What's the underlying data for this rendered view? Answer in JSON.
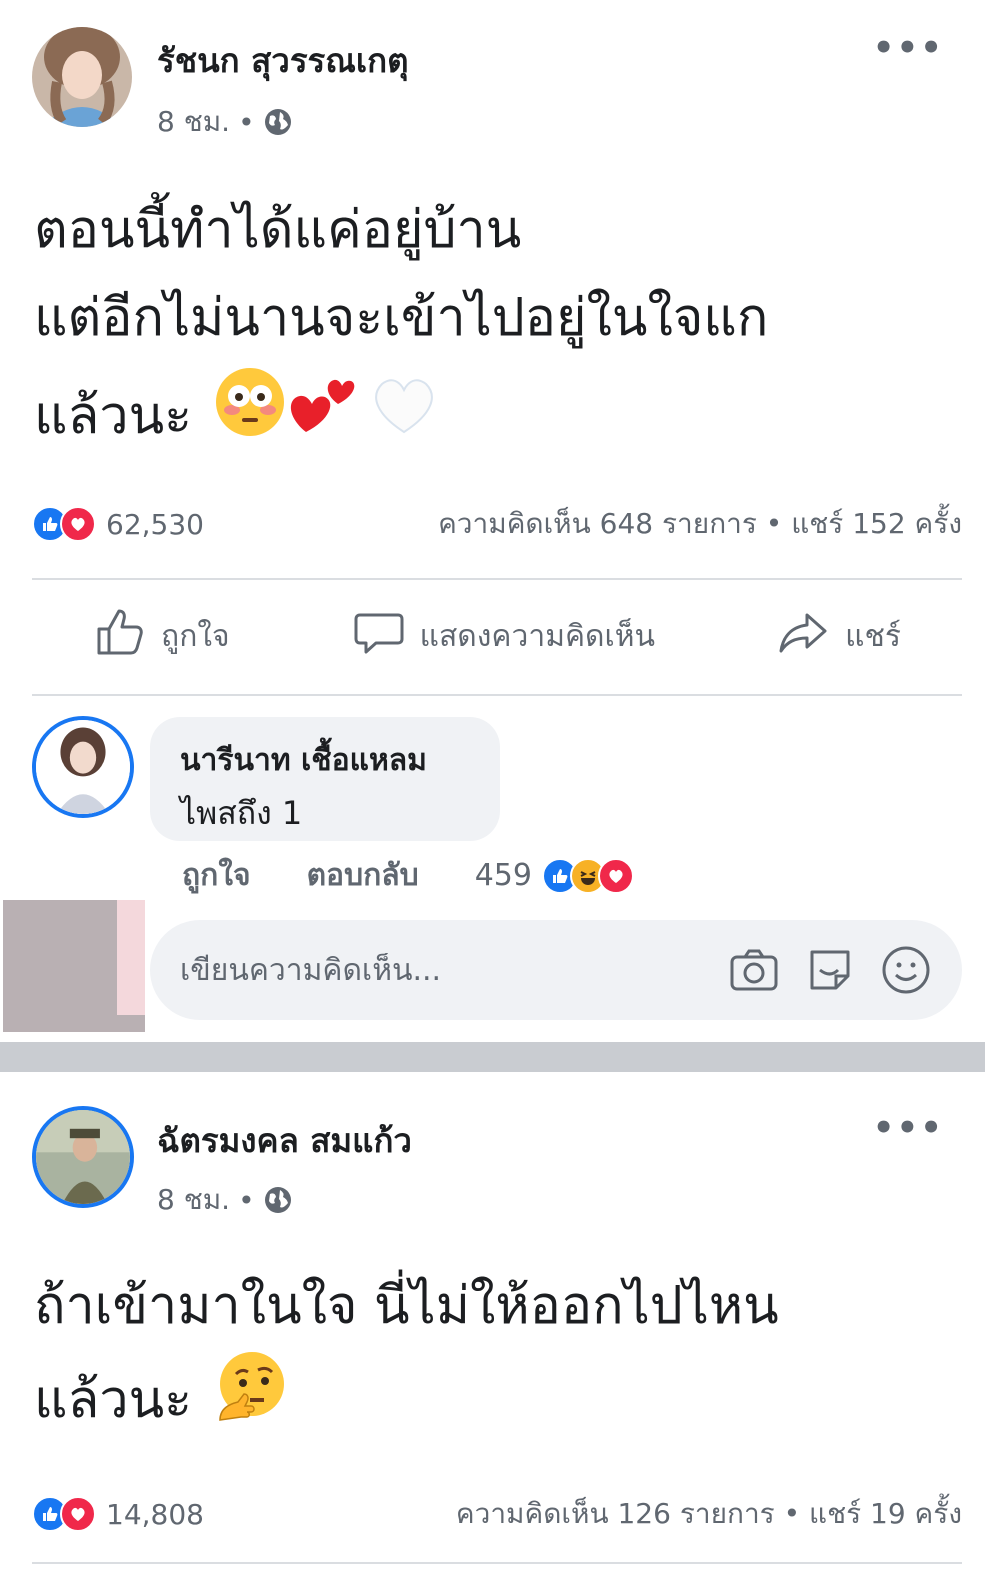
{
  "posts": [
    {
      "author": "รัชนก สุวรรณเกตุ",
      "time": "8 ชม.",
      "dot": "•",
      "more": "•••",
      "lines": [
        "ตอนนี้ทำได้แค่อยู่บ้าน",
        "แต่อีกไม่นานจะเข้าไปอยู่ในใจแก",
        "แล้วนะ"
      ],
      "reactions_count": "62,530",
      "comments_shares": "ความคิดเห็น 648 รายการ • แชร์ 152 ครั้ง",
      "actions": {
        "like": "ถูกใจ",
        "comment": "แสดงความคิดเห็น",
        "share": "แชร์"
      },
      "comment": {
        "author": "นารีนาท เชื้อแหลม",
        "text": "ไพสถึง 1",
        "like": "ถูกใจ",
        "reply": "ตอบกลับ",
        "reaction_count": "459"
      },
      "write_placeholder": "เขียนความคิดเห็น..."
    },
    {
      "author": "ฉัตรมงคล สมแก้ว",
      "time": "8 ชม.",
      "dot": "•",
      "more": "•••",
      "lines": [
        "ถ้าเข้ามาในใจ นี่ไม่ให้ออกไปไหน",
        "แล้วนะ"
      ],
      "reactions_count": "14,808",
      "comments_shares": "ความคิดเห็น 126 รายการ • แชร์ 19 ครั้ง"
    }
  ],
  "icons": {
    "post1_emojis": [
      "flushed-face-emoji",
      "two-hearts-emoji",
      "white-heart-emoji"
    ],
    "post2_emojis": [
      "thinking-face-emoji"
    ],
    "reactions": [
      "like-reaction-icon",
      "love-reaction-icon",
      "haha-reaction-icon"
    ],
    "write_box": [
      "camera-icon",
      "sticker-icon",
      "smiley-icon"
    ]
  },
  "colors": {
    "like_blue": "#1877f2",
    "love_red": "#f0284a",
    "haha_yellow": "#f7b125",
    "text_gray": "#606770",
    "bubble_bg": "#f0f2f5",
    "separator": "#c9ccd1"
  }
}
